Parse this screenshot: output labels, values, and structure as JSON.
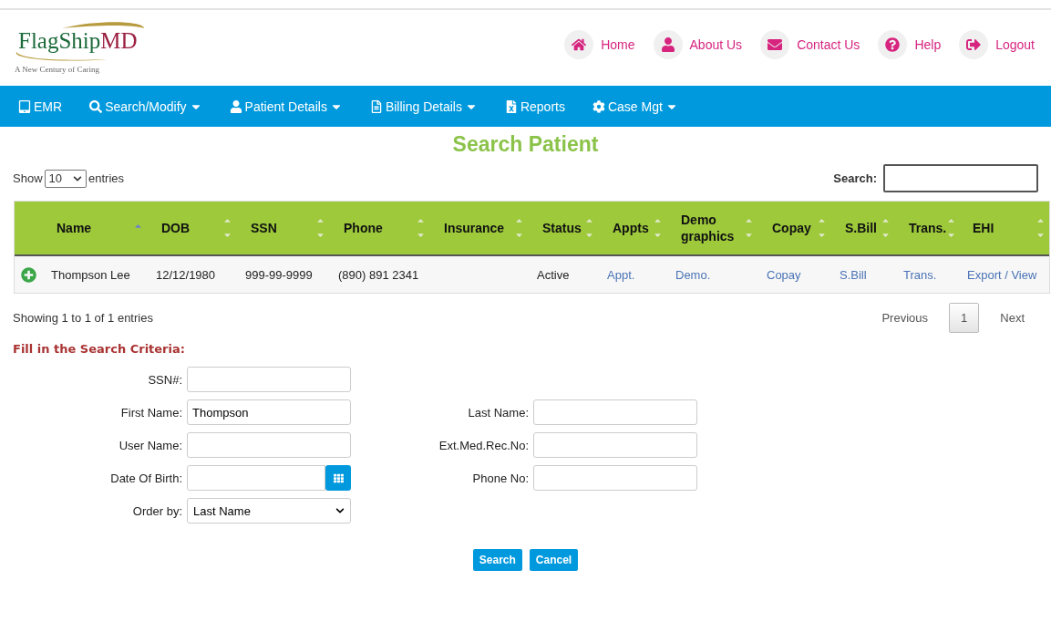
{
  "logo": {
    "name_part1": "FlagShip",
    "name_part2": "MD",
    "tagline": "A New Century of Caring"
  },
  "top_links": [
    {
      "label": "Home"
    },
    {
      "label": "About Us"
    },
    {
      "label": "Contact Us"
    },
    {
      "label": "Help"
    },
    {
      "label": "Logout"
    }
  ],
  "nav": [
    {
      "label": "EMR",
      "dropdown": false
    },
    {
      "label": "Search/Modify",
      "dropdown": true
    },
    {
      "label": "Patient Details",
      "dropdown": true
    },
    {
      "label": "Billing Details",
      "dropdown": true
    },
    {
      "label": "Reports",
      "dropdown": false
    },
    {
      "label": "Case Mgt",
      "dropdown": true
    }
  ],
  "title": "Search Patient",
  "length_control": {
    "before": "Show",
    "value": "10",
    "after": "entries"
  },
  "table_search": {
    "label": "Search:"
  },
  "table": {
    "columns": [
      {
        "label": "Name",
        "sorted": true
      },
      {
        "label": "DOB",
        "sorted": false
      },
      {
        "label": "SSN",
        "sorted": false
      },
      {
        "label": "Phone",
        "sorted": false
      },
      {
        "label": "Insurance",
        "sorted": false
      },
      {
        "label": "Status",
        "sorted": false
      },
      {
        "label": "Appts",
        "sorted": false
      },
      {
        "label": "Demo graphics",
        "sorted": false
      },
      {
        "label": "Copay",
        "sorted": false
      },
      {
        "label": "S.Bill",
        "sorted": false
      },
      {
        "label": "Trans.",
        "sorted": false
      },
      {
        "label": "EHI",
        "sorted": false
      }
    ],
    "rows": [
      {
        "expanded": false,
        "cells": [
          {
            "kind": "text",
            "text": "Thompson Lee"
          },
          {
            "kind": "text",
            "text": "12/12/1980"
          },
          {
            "kind": "text",
            "text": "999-99-9999"
          },
          {
            "kind": "text",
            "text": "(890) 891 2341"
          },
          {
            "kind": "empty"
          },
          {
            "kind": "text",
            "text": "Active"
          },
          {
            "kind": "link",
            "text": "Appt."
          },
          {
            "kind": "link",
            "text": "Demo."
          },
          {
            "kind": "link",
            "text": "Copay"
          },
          {
            "kind": "link",
            "text": "S.Bill"
          },
          {
            "kind": "link",
            "text": "Trans."
          },
          {
            "kind": "link",
            "text": "Export / View"
          }
        ]
      }
    ]
  },
  "info": "Showing 1 to 1 of 1 entries",
  "pagination": [
    {
      "label": "Previous",
      "selected": false
    },
    {
      "label": "1",
      "selected": true
    },
    {
      "label": "Next",
      "selected": false
    }
  ],
  "form": {
    "heading": "Fill in the Search Criteria:",
    "left": [
      {
        "label": "SSN#:",
        "kind": "text"
      },
      {
        "label": "First Name:",
        "kind": "text",
        "value": "Thompson"
      },
      {
        "label": "User Name:",
        "kind": "text"
      },
      {
        "label": "Date Of Birth:",
        "kind": "date"
      },
      {
        "label": "Order by:",
        "kind": "select",
        "value": "Last Name"
      }
    ],
    "right": [
      {
        "kind": "none"
      },
      {
        "label": "Last Name:",
        "kind": "text"
      },
      {
        "label": "Ext.Med.Rec.No:",
        "kind": "text"
      },
      {
        "label": "Phone No:",
        "kind": "text"
      },
      {
        "kind": "none"
      }
    ],
    "buttons": [
      {
        "label": "Search"
      },
      {
        "label": "Cancel"
      }
    ]
  }
}
